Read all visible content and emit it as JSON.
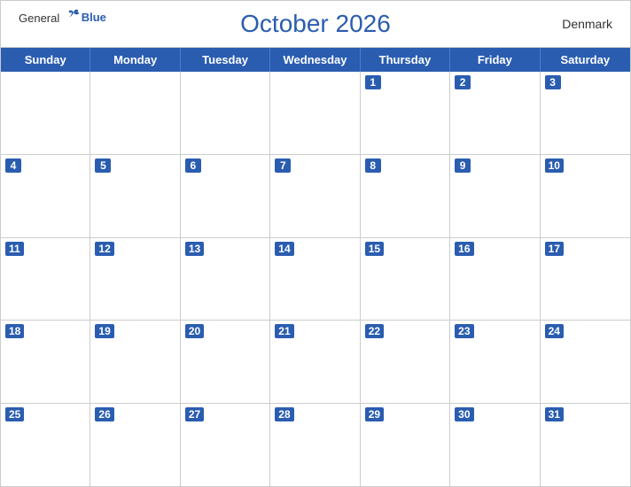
{
  "header": {
    "logo_general": "General",
    "logo_blue": "Blue",
    "title": "October 2026",
    "country": "Denmark"
  },
  "days_of_week": [
    "Sunday",
    "Monday",
    "Tuesday",
    "Wednesday",
    "Thursday",
    "Friday",
    "Saturday"
  ],
  "weeks": [
    [
      null,
      null,
      null,
      null,
      1,
      2,
      3
    ],
    [
      4,
      5,
      6,
      7,
      8,
      9,
      10
    ],
    [
      11,
      12,
      13,
      14,
      15,
      16,
      17
    ],
    [
      18,
      19,
      20,
      21,
      22,
      23,
      24
    ],
    [
      25,
      26,
      27,
      28,
      29,
      30,
      31
    ]
  ]
}
